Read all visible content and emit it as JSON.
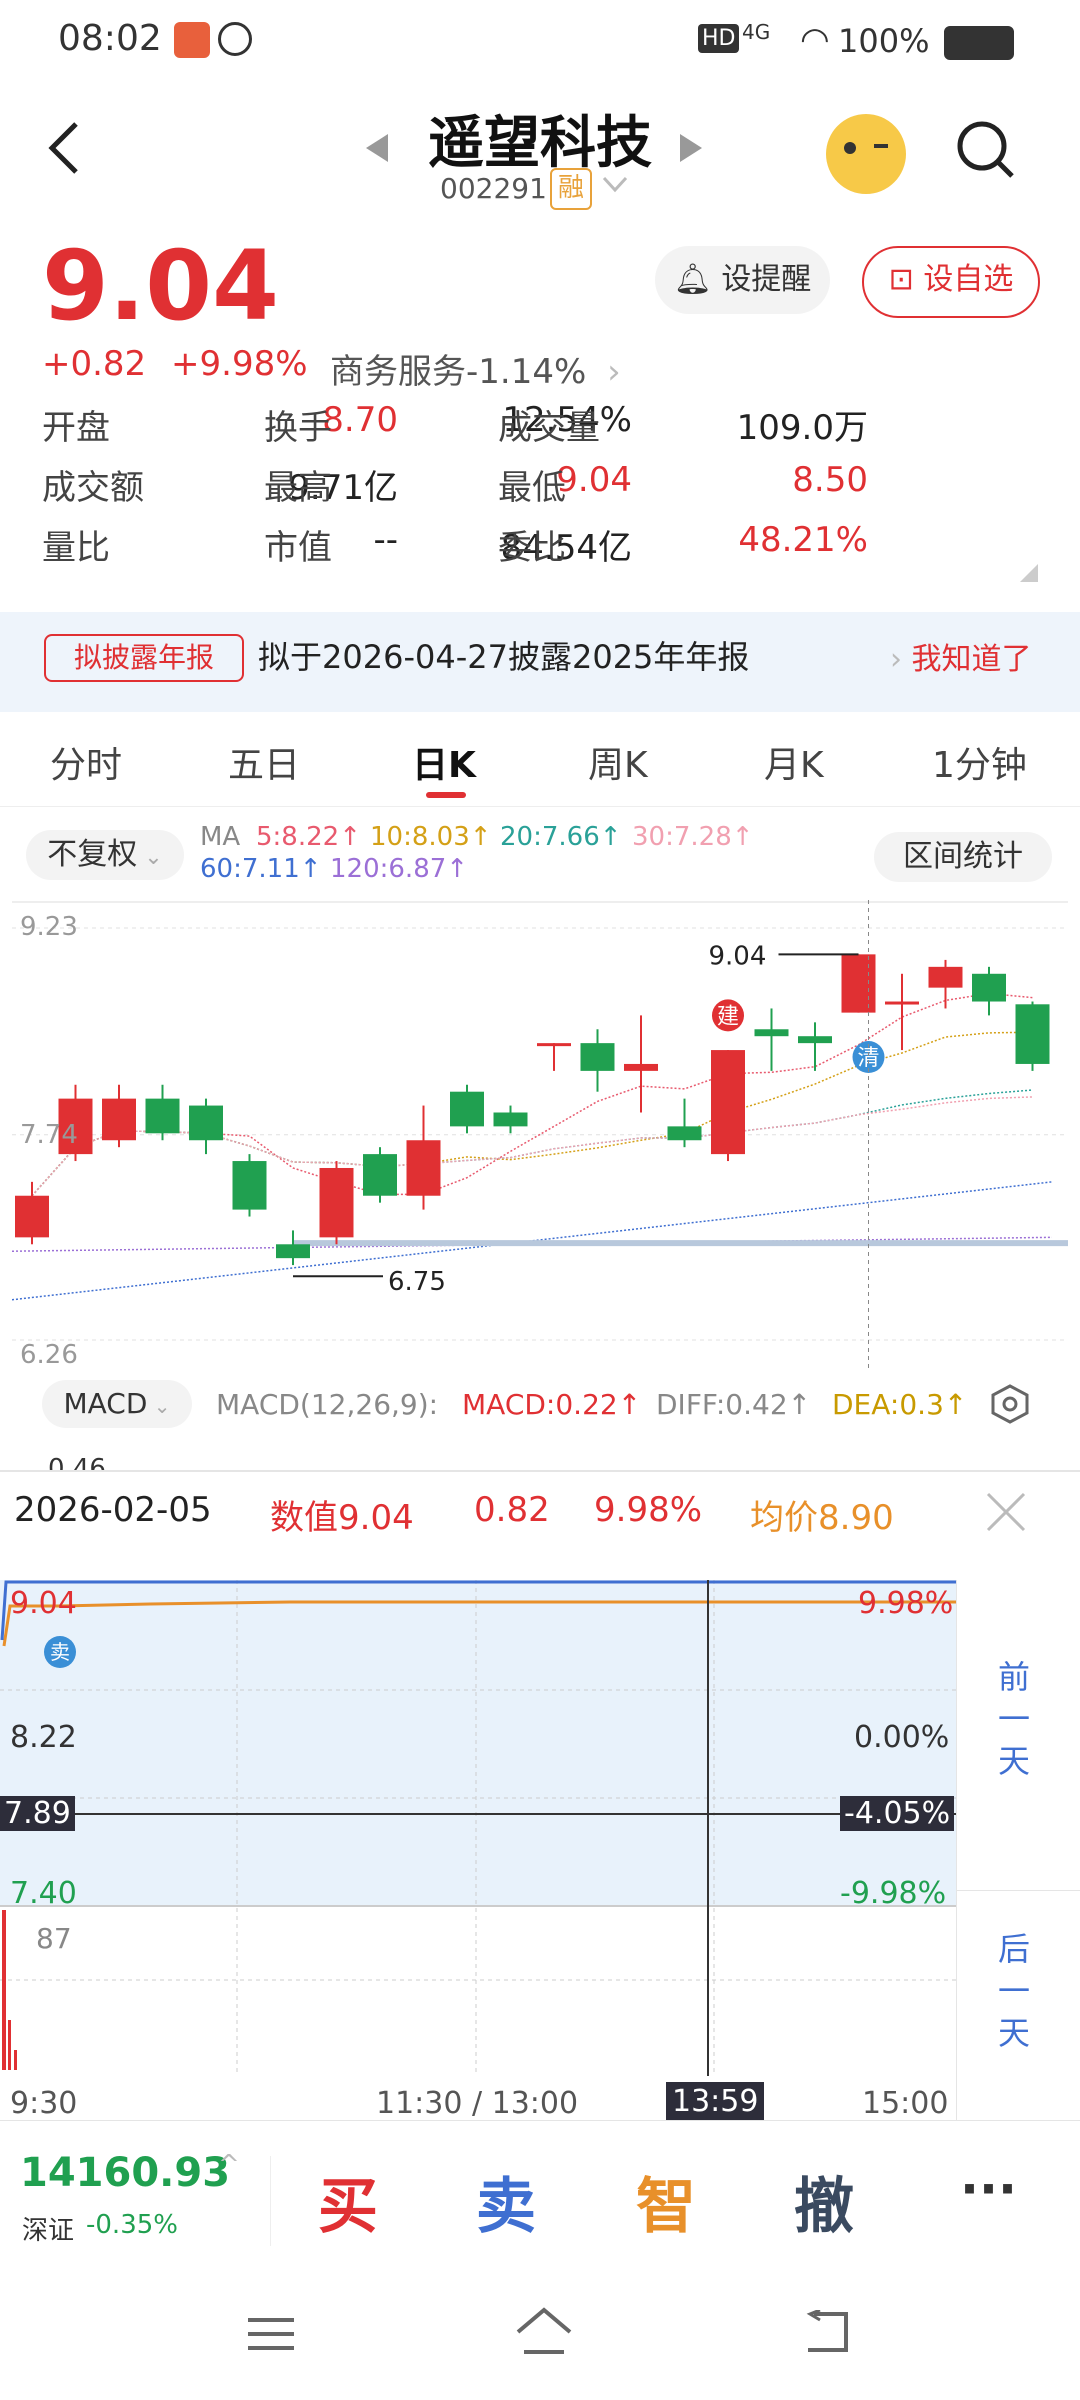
{
  "status": {
    "time": "08:02",
    "battery": "100%",
    "network": "4G",
    "hd": "HD"
  },
  "header": {
    "back": "back-icon",
    "stock_name": "遥望科技",
    "code": "002291",
    "rong": "融"
  },
  "quote": {
    "price": "9.04",
    "change": "+0.82",
    "change_pct": "+9.98%",
    "sector": "商务服务",
    "sector_pct": "-1.14%",
    "remind_label": "设提醒",
    "fav_label": "设自选",
    "stats": [
      [
        {
          "label": "开盘",
          "value": "8.70",
          "color": "#e03033"
        },
        {
          "label": "换手",
          "value": "12.54%",
          "color": "#222"
        },
        {
          "label": "成交量",
          "value": "109.0万",
          "color": "#222"
        }
      ],
      [
        {
          "label": "成交额",
          "value": "9.71亿",
          "color": "#222"
        },
        {
          "label": "最高",
          "value": "9.04",
          "color": "#e03033"
        },
        {
          "label": "最低",
          "value": "8.50",
          "color": "#e03033"
        }
      ],
      [
        {
          "label": "量比",
          "value": "--",
          "color": "#222"
        },
        {
          "label": "市值",
          "value": "84.54亿",
          "color": "#222"
        },
        {
          "label": "委比",
          "value": "48.21%",
          "color": "#e03033"
        }
      ]
    ]
  },
  "notice": {
    "tag": "拟披露年报",
    "text": "拟于2026-04-27披露2025年年报",
    "action": "我知道了"
  },
  "tabs": [
    "分时",
    "五日",
    "日K",
    "周K",
    "月K",
    "1分钟"
  ],
  "active_tab": "日K",
  "ma": {
    "mode": "不复权",
    "label": "MA",
    "ma5": "5:8.22↑",
    "ma10": "10:8.03↑",
    "ma20": "20:7.66↑",
    "ma30": "30:7.28↑",
    "ma60": "60:7.11↑",
    "ma120": "120:6.87↑",
    "stat_btn": "区间统计",
    "colors": {
      "ma5": "#e85a6e",
      "ma10": "#d4a017",
      "ma20": "#2aa198",
      "ma30": "#f1a0b0",
      "ma60": "#3f6fd1",
      "ma120": "#9b6fd6"
    }
  },
  "chart_data": {
    "type": "candlestick",
    "y_ticks": [
      "9.23",
      "7.74",
      "6.26"
    ],
    "annotations": {
      "high": "9.04",
      "low": "6.75",
      "buy_mark": "建",
      "clear_mark": "清"
    },
    "candles": [
      {
        "o": 7.0,
        "c": 7.3,
        "h": 7.4,
        "l": 6.95
      },
      {
        "o": 7.6,
        "c": 8.0,
        "h": 8.1,
        "l": 7.55
      },
      {
        "o": 7.7,
        "c": 8.0,
        "h": 8.1,
        "l": 7.65
      },
      {
        "o": 8.0,
        "c": 7.75,
        "h": 8.1,
        "l": 7.7
      },
      {
        "o": 7.95,
        "c": 7.7,
        "h": 8.0,
        "l": 7.6
      },
      {
        "o": 7.55,
        "c": 7.2,
        "h": 7.6,
        "l": 7.15
      },
      {
        "o": 6.95,
        "c": 6.85,
        "h": 7.05,
        "l": 6.8
      },
      {
        "o": 7.0,
        "c": 7.5,
        "h": 7.55,
        "l": 6.95
      },
      {
        "o": 7.6,
        "c": 7.3,
        "h": 7.65,
        "l": 7.25
      },
      {
        "o": 7.3,
        "c": 7.7,
        "h": 7.95,
        "l": 7.2
      },
      {
        "o": 8.05,
        "c": 7.8,
        "h": 8.1,
        "l": 7.75
      },
      {
        "o": 7.9,
        "c": 7.8,
        "h": 7.95,
        "l": 7.75
      },
      {
        "o": 8.4,
        "c": 8.4,
        "h": 8.4,
        "l": 8.2
      },
      {
        "o": 8.4,
        "c": 8.2,
        "h": 8.5,
        "l": 8.05
      },
      {
        "o": 8.2,
        "c": 8.25,
        "h": 8.6,
        "l": 7.9
      },
      {
        "o": 7.8,
        "c": 7.7,
        "h": 8.0,
        "l": 7.65
      },
      {
        "o": 7.6,
        "c": 8.35,
        "h": 8.35,
        "l": 7.55
      },
      {
        "o": 8.5,
        "c": 8.45,
        "h": 8.65,
        "l": 8.2
      },
      {
        "o": 8.45,
        "c": 8.4,
        "h": 8.55,
        "l": 8.2
      },
      {
        "o": 8.62,
        "c": 9.04,
        "h": 9.04,
        "l": 8.62
      },
      {
        "o": 8.7,
        "c": 8.7,
        "h": 8.9,
        "l": 8.35
      },
      {
        "o": 8.8,
        "c": 8.95,
        "h": 9.0,
        "l": 8.65
      },
      {
        "o": 8.9,
        "c": 8.7,
        "h": 8.95,
        "l": 8.6
      },
      {
        "o": 8.68,
        "c": 8.25,
        "h": 8.7,
        "l": 8.2
      }
    ]
  },
  "macd": {
    "selector": "MACD",
    "params": "MACD(12,26,9):",
    "macd": "MACD:0.22↑",
    "diff": "DIFF:0.42↑",
    "dea": "DEA:0.3↑",
    "y": "0.46"
  },
  "intraday": {
    "date": "2026-02-05",
    "value": "数值9.04",
    "chg": "0.82",
    "pct": "9.98%",
    "avg": "均价8.90",
    "prices": [
      "9.04",
      "8.22",
      "7.89",
      "7.40"
    ],
    "pcts": [
      "9.98%",
      "0.00%",
      "-4.05%",
      "-9.98%"
    ],
    "vol": "87",
    "sell": "卖",
    "times": [
      "9:30",
      "11:30 / 13:00",
      "13:59",
      "15:00"
    ],
    "prev_day": "前一天",
    "next_day": "后一天"
  },
  "bottom": {
    "index_value": "14160.93",
    "index_name": "深证",
    "index_pct": "-0.35%",
    "buy": "买",
    "sell": "卖",
    "smart": "智",
    "cancel": "撤",
    "more": "···"
  }
}
